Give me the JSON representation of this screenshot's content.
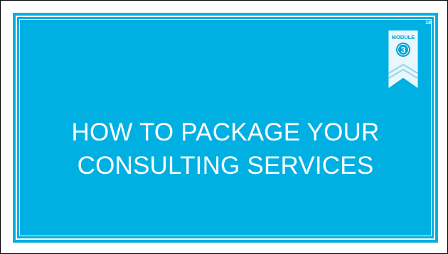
{
  "slide": {
    "number": "18",
    "badge": {
      "label": "MODULE",
      "number": "3",
      "icon": "module-ribbon-icon"
    },
    "title_lines": [
      "HOW TO PACKAGE YOUR",
      "CONSULTING SERVICES"
    ]
  },
  "colors": {
    "slide_background": "#00b0e2",
    "badge_ribbon": "#e8f7fc",
    "badge_circle": "#00a3d4",
    "text": "#ffffff"
  }
}
